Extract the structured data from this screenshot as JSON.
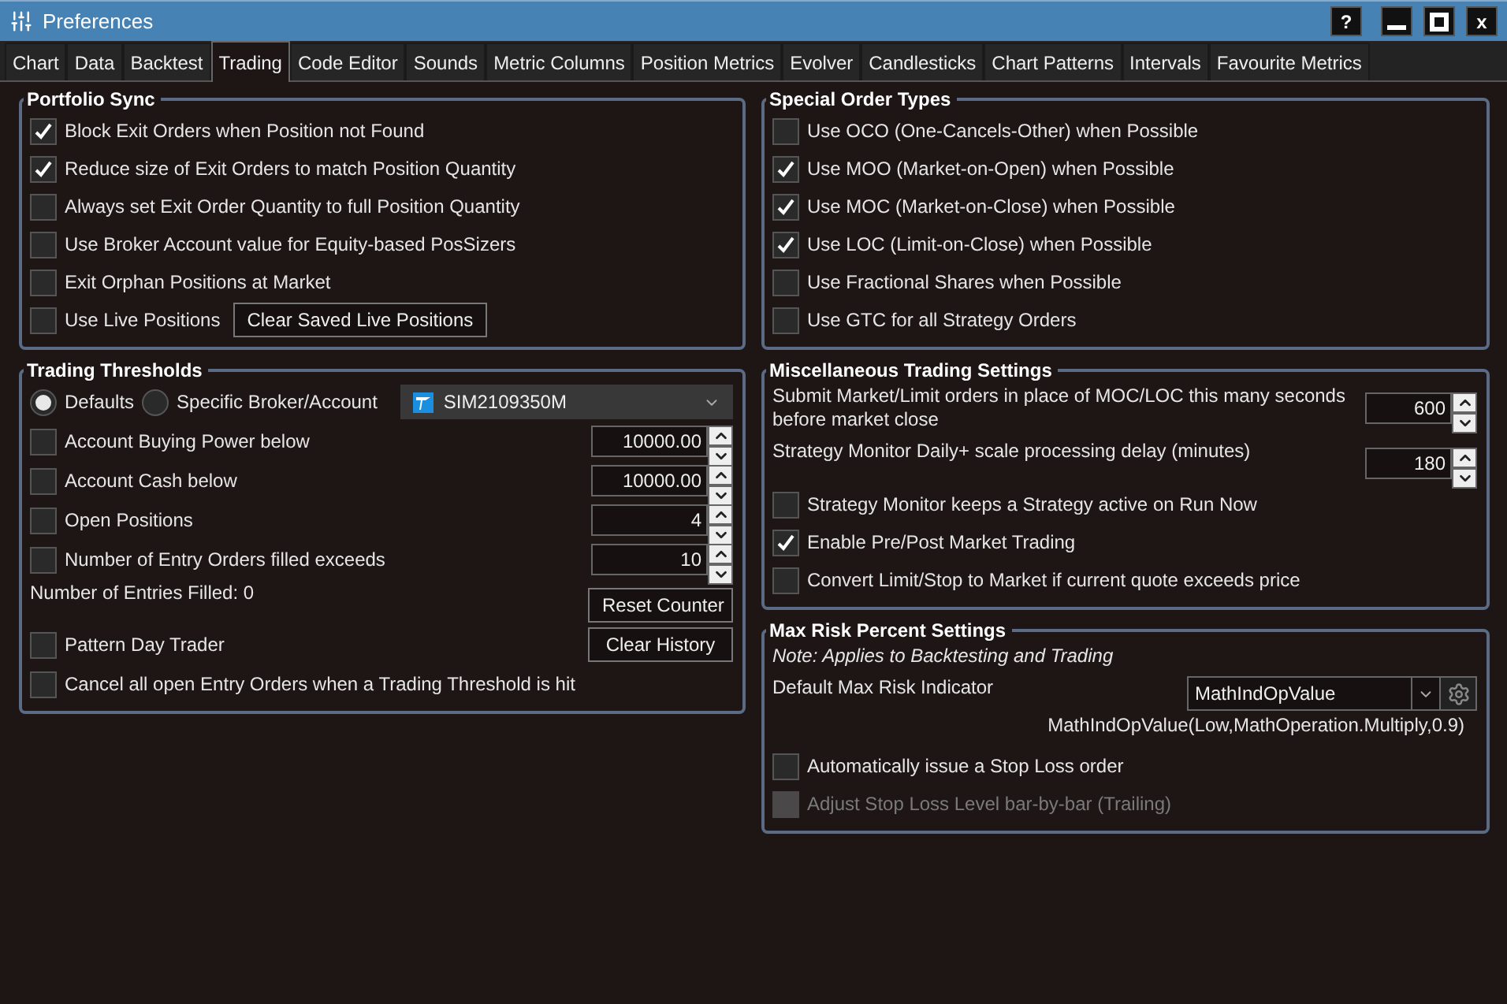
{
  "window": {
    "title": "Preferences",
    "help": "?",
    "close": "x"
  },
  "tabs": [
    {
      "label": "Chart",
      "selected": false
    },
    {
      "label": "Data",
      "selected": false
    },
    {
      "label": "Backtest",
      "selected": false
    },
    {
      "label": "Trading",
      "selected": true
    },
    {
      "label": "Code Editor",
      "selected": false
    },
    {
      "label": "Sounds",
      "selected": false
    },
    {
      "label": "Metric Columns",
      "selected": false
    },
    {
      "label": "Position Metrics",
      "selected": false
    },
    {
      "label": "Evolver",
      "selected": false
    },
    {
      "label": "Candlesticks",
      "selected": false
    },
    {
      "label": "Chart Patterns",
      "selected": false
    },
    {
      "label": "Intervals",
      "selected": false
    },
    {
      "label": "Favourite Metrics",
      "selected": false
    }
  ],
  "portfolio_sync": {
    "title": "Portfolio Sync",
    "options": [
      {
        "label": "Block Exit Orders when Position not Found",
        "checked": true
      },
      {
        "label": "Reduce size of Exit Orders to match Position Quantity",
        "checked": true
      },
      {
        "label": "Always set Exit Order Quantity to full Position Quantity",
        "checked": false
      },
      {
        "label": "Use Broker Account value for Equity-based PosSizers",
        "checked": false
      },
      {
        "label": "Exit Orphan Positions at Market",
        "checked": false
      },
      {
        "label": "Use Live Positions",
        "checked": false,
        "button": "Clear Saved Live Positions"
      }
    ]
  },
  "trading_thresholds": {
    "title": "Trading Thresholds",
    "radios": [
      {
        "label": "Defaults",
        "selected": true
      },
      {
        "label": "Specific Broker/Account",
        "selected": false
      }
    ],
    "account": "SIM2109350M",
    "thresholds": [
      {
        "label": "Account Buying Power below",
        "checked": false,
        "value": "10000.00"
      },
      {
        "label": "Account Cash below",
        "checked": false,
        "value": "10000.00"
      },
      {
        "label": "Open Positions",
        "checked": false,
        "value": "4"
      },
      {
        "label": "Number of Entry Orders filled exceeds",
        "checked": false,
        "value": "10"
      }
    ],
    "entries_filled": "Number of Entries Filled: 0",
    "reset_button": "Reset Counter",
    "pattern_day_trader": {
      "label": "Pattern Day Trader",
      "checked": false
    },
    "clear_button": "Clear History",
    "cancel_option": {
      "label": "Cancel all open Entry Orders when a Trading Threshold is hit",
      "checked": false
    }
  },
  "special_order_types": {
    "title": "Special Order Types",
    "options": [
      {
        "label": "Use OCO (One-Cancels-Other) when Possible",
        "checked": false
      },
      {
        "label": "Use MOO (Market-on-Open) when Possible",
        "checked": true
      },
      {
        "label": "Use MOC (Market-on-Close) when Possible",
        "checked": true
      },
      {
        "label": "Use LOC (Limit-on-Close) when Possible",
        "checked": true
      },
      {
        "label": "Use Fractional Shares when Possible",
        "checked": false
      },
      {
        "label": "Use GTC for all Strategy Orders",
        "checked": false
      }
    ]
  },
  "misc_trading_settings": {
    "title": "Miscellaneous Trading Settings",
    "spinners": [
      {
        "label": "Submit Market/Limit orders in place of MOC/LOC this many seconds before market close",
        "value": "600"
      },
      {
        "label": "Strategy Monitor Daily+ scale processing delay (minutes)",
        "value": "180"
      }
    ],
    "options": [
      {
        "label": "Strategy Monitor keeps a Strategy active on Run Now",
        "checked": false
      },
      {
        "label": "Enable Pre/Post Market Trading",
        "checked": true
      },
      {
        "label": "Convert Limit/Stop to Market if current quote exceeds price",
        "checked": false
      }
    ]
  },
  "max_risk": {
    "title": "Max Risk Percent Settings",
    "note": "Note: Applies to Backtesting and Trading",
    "indicator_label": "Default Max Risk Indicator",
    "indicator_value": "MathIndOpValue",
    "indicator_formula": "MathIndOpValue(Low,MathOperation.Multiply,0.9)",
    "options": [
      {
        "label": "Automatically issue a Stop Loss order",
        "checked": false,
        "disabled": false
      },
      {
        "label": "Adjust Stop Loss Level bar-by-bar (Trailing)",
        "checked": false,
        "disabled": true
      }
    ]
  }
}
